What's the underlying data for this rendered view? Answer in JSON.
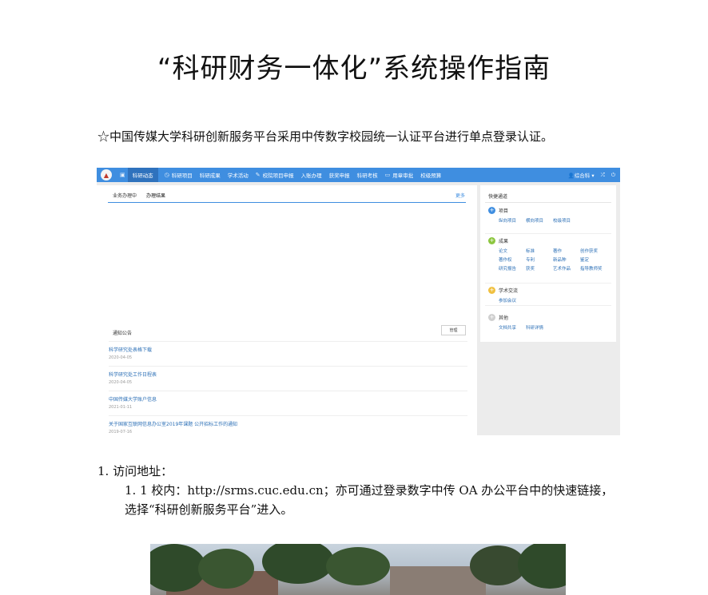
{
  "title": "“科研财务一体化”系统操作指南",
  "intro": "☆中国传媒大学科研创新服务平台采用中传数字校园统一认证平台进行单点登录认证。",
  "screenshot": {
    "nav": {
      "items": [
        "科研动态",
        "科研项目",
        "科研成果",
        "学术活动",
        "校院项目申报",
        "入账办理",
        "获奖申报",
        "科研考核",
        "用章审批",
        "校级预算"
      ],
      "user": "综合科"
    },
    "main": {
      "tabs": [
        "业务办理中",
        "办理结果"
      ],
      "more": "更多"
    },
    "notice": {
      "title": "通知公告",
      "manage": "管理",
      "rows": [
        {
          "title": "科学研究处表格下载",
          "date": "2020-04-05"
        },
        {
          "title": "科学研究处工作日程表",
          "date": "2020-04-05"
        },
        {
          "title": "中国传媒大学账户信息",
          "date": "2021-01-11"
        },
        {
          "title": "关于国家互联网信息办公室2019年课题 公开招标工作的通知",
          "date": "2019-07-16"
        }
      ]
    },
    "quick": {
      "title": "快捷通道",
      "groups": [
        {
          "name": "项目",
          "color": "#3f8ee0",
          "links": [
            "纵向项目",
            "横向项目",
            "校级项目"
          ]
        },
        {
          "name": "成果",
          "color": "#8cc63f",
          "links": [
            "论文",
            "标准",
            "著作",
            "创作获奖",
            "著作权",
            "专利",
            "新品种",
            "鉴定",
            "研究报告",
            "获奖",
            "艺术作品",
            "指导教师奖"
          ]
        },
        {
          "name": "学术交流",
          "color": "#f0c040",
          "links": [
            "参加会议"
          ]
        },
        {
          "name": "其他",
          "color": "#cfcfcf",
          "links": [
            "文档共享",
            "科研详情"
          ]
        }
      ]
    }
  },
  "section1": {
    "heading": "1. 访问地址：",
    "item_1": "1. 1 校内：http://srms.cuc.edu.cn；亦可通过登录数字中传 OA 办公平台中的快速链接，",
    "item_2": "选择“科研创新服务平台”进入。"
  }
}
